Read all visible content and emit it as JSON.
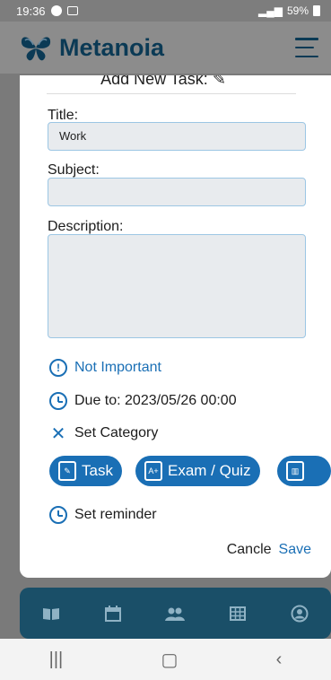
{
  "status": {
    "time": "19:36",
    "battery": "59%"
  },
  "app": {
    "title": "Metanoia"
  },
  "modal": {
    "heading": "Add New Task:",
    "title_label": "Title:",
    "title_value": "Work",
    "subject_label": "Subject:",
    "subject_value": "",
    "description_label": "Description:",
    "description_value": "",
    "importance": "Not Important",
    "due": "Due to: 2023/05/26 00:00",
    "category": "Set Category",
    "chips": [
      {
        "label": "Task"
      },
      {
        "label": "Exam / Quiz"
      }
    ],
    "reminder": "Set reminder",
    "cancel": "Cancle",
    "save": "Save"
  },
  "colors": {
    "accent": "#1a6fb5",
    "nav": "#1a4f68",
    "input_bg": "#e8ebee"
  }
}
